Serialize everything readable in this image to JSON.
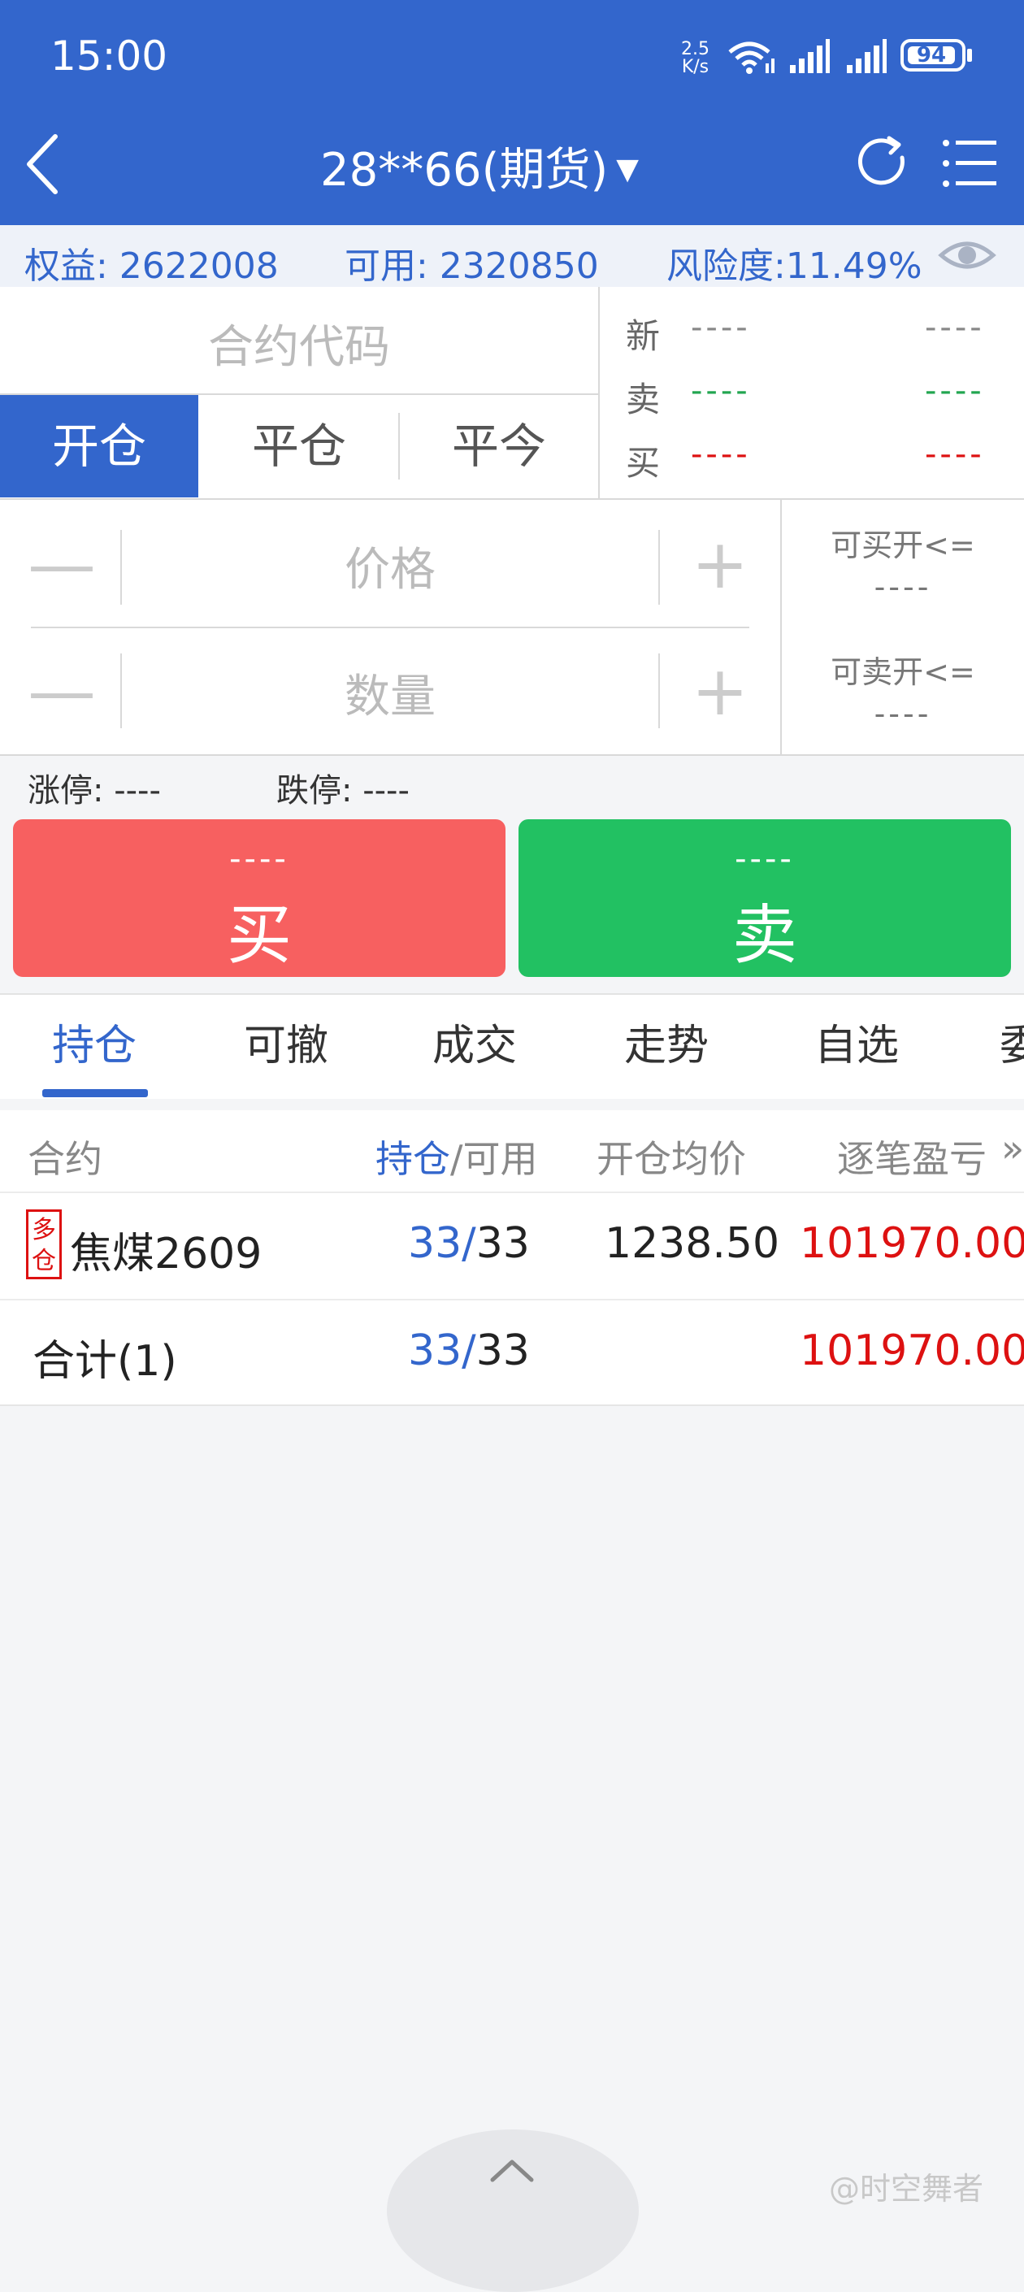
{
  "status_bar": {
    "time": "15:00",
    "net_speed_value": "2.5",
    "net_speed_unit": "K/s",
    "battery": "94"
  },
  "header": {
    "title": "28**66(期货)",
    "caret": "▼"
  },
  "account": {
    "equity_label": "权益: 2622008",
    "available_label": "可用: 2320850",
    "risk_label": "风险度:11.49%"
  },
  "order": {
    "contract_placeholder": "合约代码",
    "tabs": [
      "开仓",
      "平仓",
      "平今"
    ],
    "quote_labels": {
      "last": "新",
      "ask": "卖",
      "bid": "买"
    },
    "quote_dash": "----",
    "price_placeholder": "价格",
    "qty_placeholder": "数量",
    "minus": "—",
    "plus": "+",
    "can_buy_open_label": "可买开<=",
    "can_sell_open_label": "可卖开<=",
    "can_buy_open_value": "----",
    "can_sell_open_value": "----",
    "limit_up": "涨停: ----",
    "limit_down": "跌停: ----",
    "buy_price": "----",
    "buy_label": "买",
    "sell_price": "----",
    "sell_label": "卖"
  },
  "bottom_tabs": [
    "持仓",
    "可撤",
    "成交",
    "走势",
    "自选",
    "委"
  ],
  "table": {
    "headers": {
      "contract": "合约",
      "position": "持仓",
      "available": "/可用",
      "avg_price": "开仓均价",
      "pnl": "逐笔盈亏",
      "more": "»"
    },
    "rows": [
      {
        "badge_top": "多",
        "badge_bottom": "仓",
        "name": "焦煤2609",
        "position": "33/",
        "available": "33",
        "avg_price": "1238.50",
        "pnl": "101970.00"
      }
    ],
    "total": {
      "label": "合计(1)",
      "position": "33/",
      "available": "33",
      "pnl": "101970.00"
    }
  },
  "watermark": "@时空舞者",
  "colors": {
    "brand": "#3366cc",
    "buy": "#f76060",
    "sell": "#22c162",
    "profit": "#dd1111"
  }
}
